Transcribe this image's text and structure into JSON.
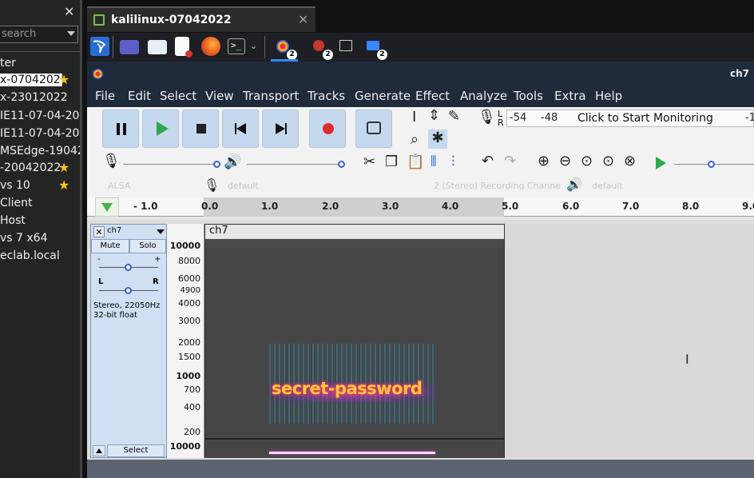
{
  "sidebar": {
    "search_placeholder": "search",
    "items": [
      {
        "label": "ter"
      },
      {
        "label": "x-0704202",
        "starred": true,
        "selected": true
      },
      {
        "label": "x-23012022"
      },
      {
        "label": "IE11-07-04-20"
      },
      {
        "label": "IE11-07-04-20"
      },
      {
        "label": "MSEdge-19042"
      },
      {
        "label": "-20042022",
        "starred": true
      },
      {
        "label": "vs 10",
        "starred": true
      },
      {
        "label": "Client"
      },
      {
        "label": "Host"
      },
      {
        "label": "vs 7 x64"
      },
      {
        "label": "eclab.local"
      }
    ]
  },
  "vm_tab": {
    "title": "kalilinux-07042022"
  },
  "taskbar": {
    "badges": [
      "2",
      "2",
      "2"
    ]
  },
  "audacity": {
    "window_title": "ch7",
    "menu": [
      "File",
      "Edit",
      "Select",
      "View",
      "Transport",
      "Tracks",
      "Generate",
      "Effect",
      "Analyze",
      "Tools",
      "Extra",
      "Help"
    ],
    "meter": {
      "lr_labels": [
        "L",
        "R"
      ],
      "db_labels": [
        "-54",
        "-48",
        "-1"
      ],
      "monitor_text": "Click to Start Monitoring"
    },
    "device_toolbar": {
      "host": "ALSA",
      "input": "default",
      "channels": "2 (Stereo) Recording Channe",
      "output": "default"
    },
    "ruler": {
      "labels": [
        "- 1.0",
        "0.0",
        "1.0",
        "2.0",
        "3.0",
        "4.0",
        "5.0",
        "6.0",
        "7.0",
        "8.0",
        "9.0"
      ]
    },
    "track": {
      "name": "ch7",
      "mute": "Mute",
      "solo": "Solo",
      "gain_min": "-",
      "gain_max": "+",
      "pan_left": "L",
      "pan_right": "R",
      "info_line1": "Stereo, 22050Hz",
      "info_line2": "32-bit float",
      "select": "Select"
    },
    "clip": {
      "name": "ch7",
      "hidden_text": "secret-password"
    },
    "vscale": [
      "10000",
      "8000",
      "6000",
      "4900",
      "4000",
      "3000",
      "2000",
      "1500",
      "1000",
      "700",
      "400",
      "200",
      "10000"
    ]
  }
}
